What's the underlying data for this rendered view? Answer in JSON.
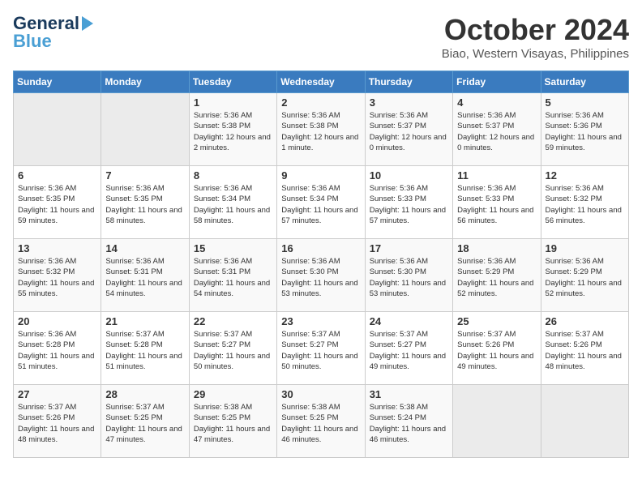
{
  "logo": {
    "general": "General",
    "blue": "Blue"
  },
  "header": {
    "month": "October 2024",
    "location": "Biao, Western Visayas, Philippines"
  },
  "weekdays": [
    "Sunday",
    "Monday",
    "Tuesday",
    "Wednesday",
    "Thursday",
    "Friday",
    "Saturday"
  ],
  "weeks": [
    [
      {
        "day": "",
        "sunrise": "",
        "sunset": "",
        "daylight": ""
      },
      {
        "day": "",
        "sunrise": "",
        "sunset": "",
        "daylight": ""
      },
      {
        "day": "1",
        "sunrise": "Sunrise: 5:36 AM",
        "sunset": "Sunset: 5:38 PM",
        "daylight": "Daylight: 12 hours and 2 minutes."
      },
      {
        "day": "2",
        "sunrise": "Sunrise: 5:36 AM",
        "sunset": "Sunset: 5:38 PM",
        "daylight": "Daylight: 12 hours and 1 minute."
      },
      {
        "day": "3",
        "sunrise": "Sunrise: 5:36 AM",
        "sunset": "Sunset: 5:37 PM",
        "daylight": "Daylight: 12 hours and 0 minutes."
      },
      {
        "day": "4",
        "sunrise": "Sunrise: 5:36 AM",
        "sunset": "Sunset: 5:37 PM",
        "daylight": "Daylight: 12 hours and 0 minutes."
      },
      {
        "day": "5",
        "sunrise": "Sunrise: 5:36 AM",
        "sunset": "Sunset: 5:36 PM",
        "daylight": "Daylight: 11 hours and 59 minutes."
      }
    ],
    [
      {
        "day": "6",
        "sunrise": "Sunrise: 5:36 AM",
        "sunset": "Sunset: 5:35 PM",
        "daylight": "Daylight: 11 hours and 59 minutes."
      },
      {
        "day": "7",
        "sunrise": "Sunrise: 5:36 AM",
        "sunset": "Sunset: 5:35 PM",
        "daylight": "Daylight: 11 hours and 58 minutes."
      },
      {
        "day": "8",
        "sunrise": "Sunrise: 5:36 AM",
        "sunset": "Sunset: 5:34 PM",
        "daylight": "Daylight: 11 hours and 58 minutes."
      },
      {
        "day": "9",
        "sunrise": "Sunrise: 5:36 AM",
        "sunset": "Sunset: 5:34 PM",
        "daylight": "Daylight: 11 hours and 57 minutes."
      },
      {
        "day": "10",
        "sunrise": "Sunrise: 5:36 AM",
        "sunset": "Sunset: 5:33 PM",
        "daylight": "Daylight: 11 hours and 57 minutes."
      },
      {
        "day": "11",
        "sunrise": "Sunrise: 5:36 AM",
        "sunset": "Sunset: 5:33 PM",
        "daylight": "Daylight: 11 hours and 56 minutes."
      },
      {
        "day": "12",
        "sunrise": "Sunrise: 5:36 AM",
        "sunset": "Sunset: 5:32 PM",
        "daylight": "Daylight: 11 hours and 56 minutes."
      }
    ],
    [
      {
        "day": "13",
        "sunrise": "Sunrise: 5:36 AM",
        "sunset": "Sunset: 5:32 PM",
        "daylight": "Daylight: 11 hours and 55 minutes."
      },
      {
        "day": "14",
        "sunrise": "Sunrise: 5:36 AM",
        "sunset": "Sunset: 5:31 PM",
        "daylight": "Daylight: 11 hours and 54 minutes."
      },
      {
        "day": "15",
        "sunrise": "Sunrise: 5:36 AM",
        "sunset": "Sunset: 5:31 PM",
        "daylight": "Daylight: 11 hours and 54 minutes."
      },
      {
        "day": "16",
        "sunrise": "Sunrise: 5:36 AM",
        "sunset": "Sunset: 5:30 PM",
        "daylight": "Daylight: 11 hours and 53 minutes."
      },
      {
        "day": "17",
        "sunrise": "Sunrise: 5:36 AM",
        "sunset": "Sunset: 5:30 PM",
        "daylight": "Daylight: 11 hours and 53 minutes."
      },
      {
        "day": "18",
        "sunrise": "Sunrise: 5:36 AM",
        "sunset": "Sunset: 5:29 PM",
        "daylight": "Daylight: 11 hours and 52 minutes."
      },
      {
        "day": "19",
        "sunrise": "Sunrise: 5:36 AM",
        "sunset": "Sunset: 5:29 PM",
        "daylight": "Daylight: 11 hours and 52 minutes."
      }
    ],
    [
      {
        "day": "20",
        "sunrise": "Sunrise: 5:36 AM",
        "sunset": "Sunset: 5:28 PM",
        "daylight": "Daylight: 11 hours and 51 minutes."
      },
      {
        "day": "21",
        "sunrise": "Sunrise: 5:37 AM",
        "sunset": "Sunset: 5:28 PM",
        "daylight": "Daylight: 11 hours and 51 minutes."
      },
      {
        "day": "22",
        "sunrise": "Sunrise: 5:37 AM",
        "sunset": "Sunset: 5:27 PM",
        "daylight": "Daylight: 11 hours and 50 minutes."
      },
      {
        "day": "23",
        "sunrise": "Sunrise: 5:37 AM",
        "sunset": "Sunset: 5:27 PM",
        "daylight": "Daylight: 11 hours and 50 minutes."
      },
      {
        "day": "24",
        "sunrise": "Sunrise: 5:37 AM",
        "sunset": "Sunset: 5:27 PM",
        "daylight": "Daylight: 11 hours and 49 minutes."
      },
      {
        "day": "25",
        "sunrise": "Sunrise: 5:37 AM",
        "sunset": "Sunset: 5:26 PM",
        "daylight": "Daylight: 11 hours and 49 minutes."
      },
      {
        "day": "26",
        "sunrise": "Sunrise: 5:37 AM",
        "sunset": "Sunset: 5:26 PM",
        "daylight": "Daylight: 11 hours and 48 minutes."
      }
    ],
    [
      {
        "day": "27",
        "sunrise": "Sunrise: 5:37 AM",
        "sunset": "Sunset: 5:26 PM",
        "daylight": "Daylight: 11 hours and 48 minutes."
      },
      {
        "day": "28",
        "sunrise": "Sunrise: 5:37 AM",
        "sunset": "Sunset: 5:25 PM",
        "daylight": "Daylight: 11 hours and 47 minutes."
      },
      {
        "day": "29",
        "sunrise": "Sunrise: 5:38 AM",
        "sunset": "Sunset: 5:25 PM",
        "daylight": "Daylight: 11 hours and 47 minutes."
      },
      {
        "day": "30",
        "sunrise": "Sunrise: 5:38 AM",
        "sunset": "Sunset: 5:25 PM",
        "daylight": "Daylight: 11 hours and 46 minutes."
      },
      {
        "day": "31",
        "sunrise": "Sunrise: 5:38 AM",
        "sunset": "Sunset: 5:24 PM",
        "daylight": "Daylight: 11 hours and 46 minutes."
      },
      {
        "day": "",
        "sunrise": "",
        "sunset": "",
        "daylight": ""
      },
      {
        "day": "",
        "sunrise": "",
        "sunset": "",
        "daylight": ""
      }
    ]
  ]
}
